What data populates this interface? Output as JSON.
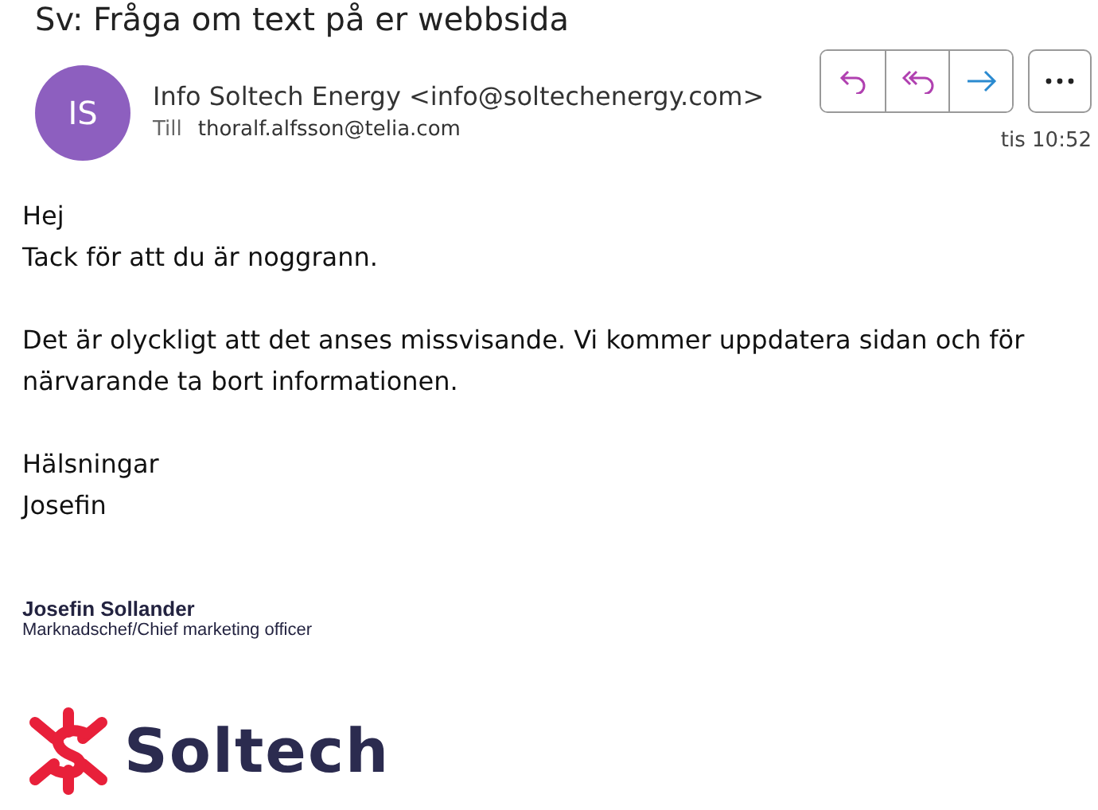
{
  "subject": "Sv: Fråga om text på er webbsida",
  "sender": {
    "initials": "IS",
    "name": "Info Soltech Energy <info@soltechenergy.com>",
    "to_label": "Till",
    "to": "thoralf.alfsson@telia.com",
    "time": "tis 10:52"
  },
  "actions": [
    {
      "kind": "reply"
    },
    {
      "kind": "reply-all"
    },
    {
      "kind": "forward"
    }
  ],
  "body": [
    "Hej\nTack för att du är noggrann.",
    "Det är olyckligt att det anses missvisande. Vi kommer uppdatera sidan och för närvarande ta bort informationen.",
    "Hälsningar\nJosefin"
  ],
  "signature": {
    "name": "Josefin Sollander",
    "title": "Marknadschef/Chief marketing officer",
    "logo_text": "Soltech"
  }
}
